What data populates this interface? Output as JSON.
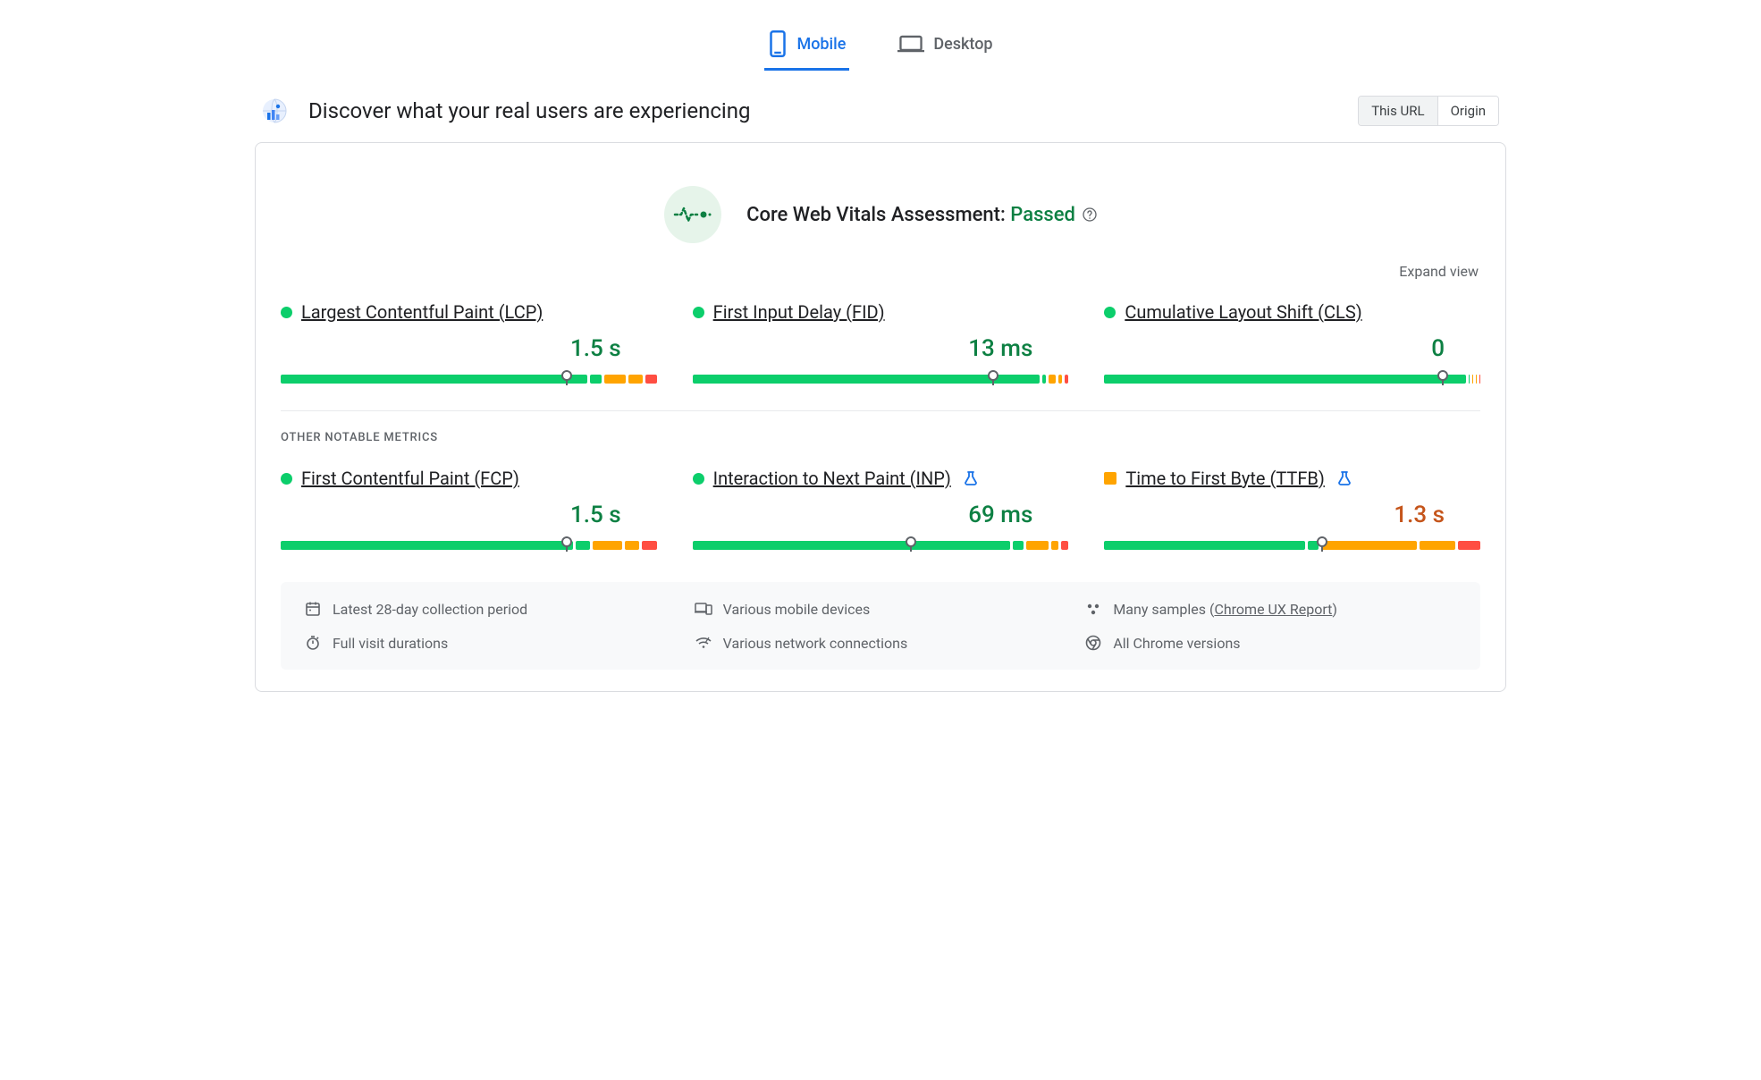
{
  "tabs": {
    "mobile": "Mobile",
    "desktop": "Desktop"
  },
  "header": {
    "title": "Discover what your real users are experiencing"
  },
  "scope": {
    "this_url": "This URL",
    "origin": "Origin"
  },
  "assessment": {
    "label": "Core Web Vitals Assessment: ",
    "status": "Passed"
  },
  "expand": "Expand view",
  "section_other": "OTHER NOTABLE METRICS",
  "metrics": {
    "lcp": {
      "name": "Largest Contentful Paint (LCP)",
      "value": "1.5 s",
      "status": "green",
      "marker": 76,
      "segs": [
        84,
        3,
        6,
        4,
        3
      ]
    },
    "fid": {
      "name": "First Input Delay (FID)",
      "value": "13 ms",
      "status": "green",
      "marker": 80,
      "segs": [
        95,
        1,
        2,
        1,
        1
      ]
    },
    "cls": {
      "name": "Cumulative Layout Shift (CLS)",
      "value": "0",
      "status": "green",
      "marker": 90,
      "segs": [
        99,
        0.3,
        0.3,
        0.2,
        0.2
      ]
    },
    "fcp": {
      "name": "First Contentful Paint (FCP)",
      "value": "1.5 s",
      "status": "green",
      "marker": 76,
      "segs": [
        80,
        4,
        8,
        4,
        4
      ]
    },
    "inp": {
      "name": "Interaction to Next Paint (INP)",
      "value": "69 ms",
      "status": "green",
      "flask": true,
      "marker": 58,
      "segs": [
        87,
        3,
        6,
        2,
        2
      ]
    },
    "ttfb": {
      "name": "Time to First Byte (TTFB)",
      "value": "1.3 s",
      "status": "orange",
      "flask": true,
      "marker": 58,
      "segs": [
        55,
        3,
        26,
        10,
        6
      ]
    }
  },
  "footer": {
    "period": "Latest 28-day collection period",
    "devices": "Various mobile devices",
    "samples_prefix": "Many samples (",
    "samples_link": "Chrome UX Report",
    "samples_suffix": ")",
    "durations": "Full visit durations",
    "network": "Various network connections",
    "versions": "All Chrome versions"
  },
  "colors": {
    "green": "#0cce6b",
    "orange": "#ffa400",
    "red": "#ff4e42"
  }
}
